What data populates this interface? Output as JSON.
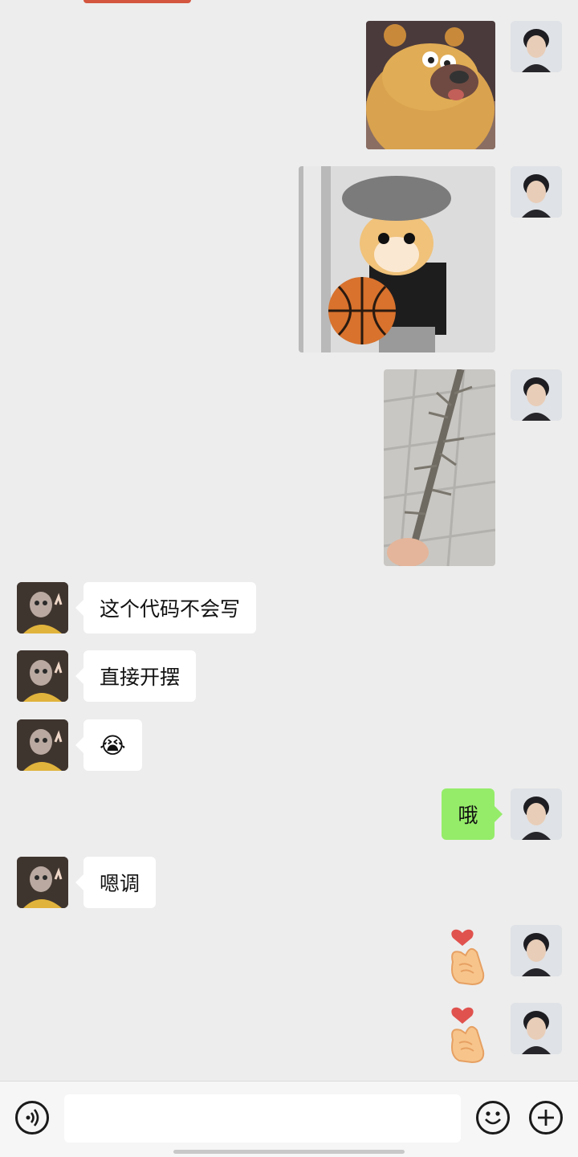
{
  "chat": {
    "messages": [
      {
        "sender": "me",
        "type": "sticker",
        "description": "cartoon bear"
      },
      {
        "sender": "me",
        "type": "sticker",
        "description": "cat with basketball"
      },
      {
        "sender": "me",
        "type": "sticker",
        "description": "thorny branch"
      },
      {
        "sender": "other",
        "type": "text",
        "text": "这个代码不会写"
      },
      {
        "sender": "other",
        "type": "text",
        "text": "直接开摆"
      },
      {
        "sender": "other",
        "type": "emoji",
        "text": "😭"
      },
      {
        "sender": "me",
        "type": "text",
        "text": "哦"
      },
      {
        "sender": "other",
        "type": "text",
        "text": "嗯调"
      },
      {
        "sender": "me",
        "type": "sticker",
        "description": "finger heart"
      },
      {
        "sender": "me",
        "type": "sticker",
        "description": "finger heart"
      }
    ]
  },
  "input_bar": {
    "voice_icon": "voice-icon",
    "emoji_icon": "emoji-icon",
    "plus_icon": "plus-icon"
  },
  "colors": {
    "background": "#ededed",
    "my_bubble": "#95ec69",
    "other_bubble": "#ffffff"
  }
}
